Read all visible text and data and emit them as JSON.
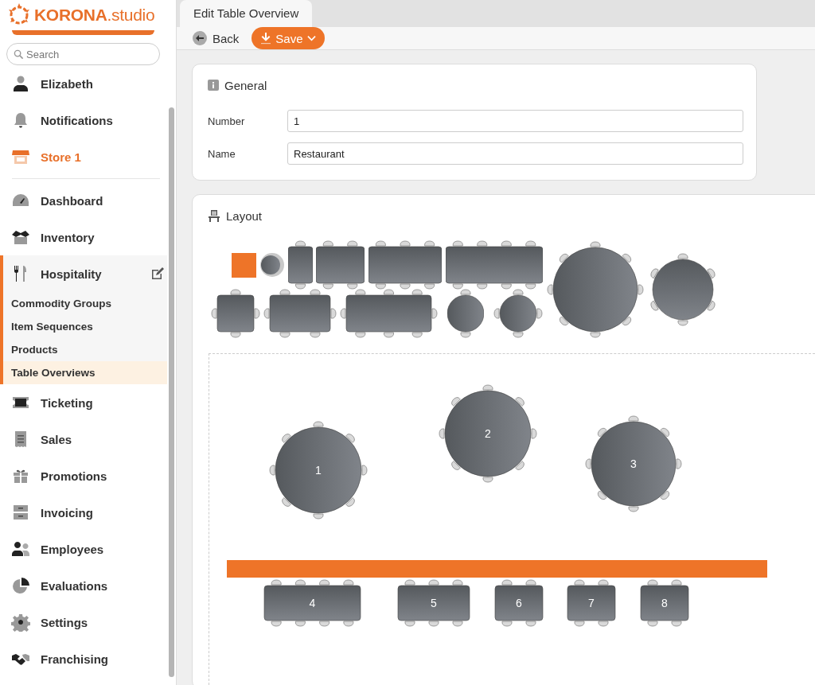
{
  "logo": {
    "brand": "KORONA",
    "suffix": ".studio"
  },
  "search": {
    "placeholder": "Search"
  },
  "sidebar": {
    "account_items": [
      {
        "label": "Elizabeth",
        "kind": "user"
      },
      {
        "label": "Notifications",
        "kind": "link"
      },
      {
        "label": "Store 1",
        "kind": "store"
      }
    ],
    "modules": [
      {
        "label": "Dashboard",
        "expanded": false
      },
      {
        "label": "Inventory",
        "expanded": false
      },
      {
        "label": "Hospitality",
        "expanded": true,
        "children": [
          {
            "label": "Commodity Groups",
            "selected": false
          },
          {
            "label": "Item Sequences",
            "selected": false
          },
          {
            "label": "Products",
            "selected": false
          },
          {
            "label": "Table Overviews",
            "selected": true
          }
        ]
      },
      {
        "label": "Ticketing",
        "expanded": false
      },
      {
        "label": "Sales",
        "expanded": false
      },
      {
        "label": "Promotions",
        "expanded": false
      },
      {
        "label": "Invoicing",
        "expanded": false
      },
      {
        "label": "Employees",
        "expanded": false
      },
      {
        "label": "Evaluations",
        "expanded": false
      },
      {
        "label": "Settings",
        "expanded": false
      },
      {
        "label": "Franchising",
        "expanded": false
      }
    ]
  },
  "tabs": [
    {
      "label": "Edit Table Overview",
      "selected": true
    }
  ],
  "toolbar": {
    "back": "Back",
    "save": "Save"
  },
  "general": {
    "title": "General",
    "fields": [
      {
        "label": "Number",
        "value": "1"
      },
      {
        "label": "Name",
        "value": "Restaurant"
      }
    ]
  },
  "layout": {
    "title": "Layout",
    "tables": [
      {
        "label": "1",
        "kind": "round"
      },
      {
        "label": "2",
        "kind": "round"
      },
      {
        "label": "3",
        "kind": "round"
      },
      {
        "label": "4",
        "kind": "rect"
      },
      {
        "label": "5",
        "kind": "rect"
      },
      {
        "label": "6",
        "kind": "rect"
      },
      {
        "label": "7",
        "kind": "rect"
      },
      {
        "label": "8",
        "kind": "rect"
      }
    ]
  }
}
